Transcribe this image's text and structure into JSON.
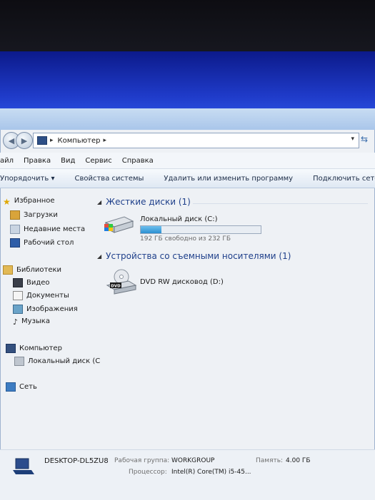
{
  "window": {
    "breadcrumb": "Компьютер",
    "menu": [
      "айл",
      "Правка",
      "Вид",
      "Сервис",
      "Справка"
    ],
    "toolbar": [
      "Упорядочить ▾",
      "Свойства системы",
      "Удалить или изменить программу",
      "Подключить сетев"
    ]
  },
  "nav": {
    "favorites": "Избранное",
    "downloads": "Загрузки",
    "recent": "Недавние места",
    "desktop": "Рабочий стол",
    "libraries": "Библиотеки",
    "video": "Видео",
    "documents": "Документы",
    "images": "Изображения",
    "music": "Музыка",
    "computer": "Компьютер",
    "local_disk": "Локальный диск (С",
    "network": "Сеть"
  },
  "content": {
    "hdd_group": "Жесткие диски (1)",
    "local_disk_name": "Локальный диск (C:)",
    "local_disk_space": "192 ГБ свободно из 232 ГБ",
    "local_disk_used_fraction": 0.17,
    "removable_group": "Устройства со съемными носителями (1)",
    "dvd_name": "DVD RW дисковод (D:)",
    "dvd_badge": "DVD"
  },
  "details": {
    "computer_name": "DESKTOP-DL5ZU8",
    "workgroup_label": "Рабочая группа:",
    "workgroup_value": "WORKGROUP",
    "memory_label": "Память:",
    "memory_value": "4.00 ГБ",
    "cpu_label": "Процессор:",
    "cpu_value": "Intel(R) Core(TM) i5-45..."
  },
  "colors": {
    "desktop": "#1f3bc9",
    "accent": "#1e3f8a",
    "bar_fill": "#2b8fd0"
  }
}
